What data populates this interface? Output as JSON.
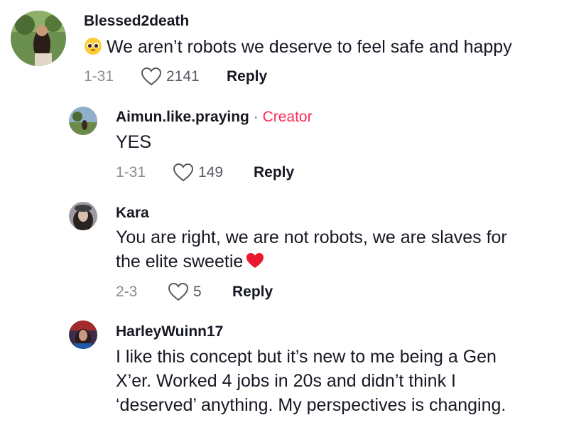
{
  "comments": [
    {
      "username": "Blessed2death",
      "text_lines": [
        "We aren’t robots we deserve to feel safe and happy"
      ],
      "leading_emoji": "pleading-face",
      "date": "1-31",
      "likes": "2141",
      "reply_label": "Reply"
    },
    {
      "username": "Aimun.like.praying",
      "separator": "·",
      "badge": "Creator",
      "text_lines": [
        "YES"
      ],
      "date": "1-31",
      "likes": "149",
      "reply_label": "Reply"
    },
    {
      "username": "Kara",
      "text_lines": [
        "You are right, we are not robots, we are slaves for",
        "the elite sweetie"
      ],
      "trailing_emoji": "red-heart",
      "date": "2-3",
      "likes": "5",
      "reply_label": "Reply"
    },
    {
      "username": "HarleyWuinn17",
      "text_lines": [
        "I like this concept but it’s new to me being a Gen",
        "X’er. Worked 4 jobs in 20s and didn’t think I",
        "‘deserved’ anything. My perspectives is changing."
      ]
    }
  ],
  "colors": {
    "creator_badge": "#fe2c55",
    "meta_gray": "#8a8b91",
    "text": "#161823"
  },
  "icons": {
    "like": "heart-outline-icon"
  }
}
